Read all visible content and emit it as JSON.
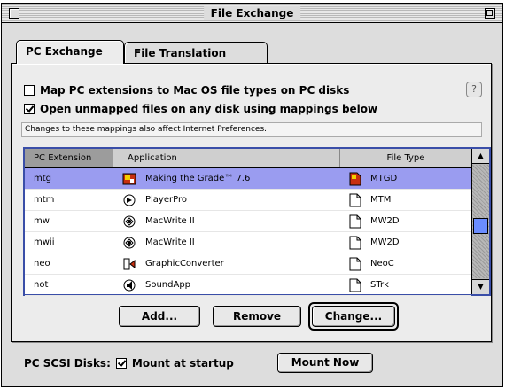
{
  "window": {
    "title": "File Exchange"
  },
  "tabs": [
    {
      "label": "PC Exchange",
      "active": true
    },
    {
      "label": "File Translation",
      "active": false
    }
  ],
  "options": {
    "map_extensions": {
      "label": "Map PC extensions to Mac OS file types on PC disks",
      "checked": false
    },
    "open_unmapped": {
      "label": "Open unmapped files on any disk using mappings below",
      "checked": true
    }
  },
  "help_label": "?",
  "notice": "Changes to these mappings also affect Internet Preferences.",
  "table": {
    "headers": {
      "extension": "PC Extension",
      "application": "Application",
      "file_type": "File Type"
    },
    "rows": [
      {
        "ext": "mtg",
        "app": "Making the Grade™ 7.6",
        "type": "MTGD",
        "selected": true,
        "icon": "grade-app-icon"
      },
      {
        "ext": "mtm",
        "app": "PlayerPro",
        "type": "MTM",
        "selected": false,
        "icon": "player-app-icon"
      },
      {
        "ext": "mw",
        "app": "MacWrite II",
        "type": "MW2D",
        "selected": false,
        "icon": "macwrite-app-icon"
      },
      {
        "ext": "mwii",
        "app": "MacWrite II",
        "type": "MW2D",
        "selected": false,
        "icon": "macwrite-app-icon"
      },
      {
        "ext": "neo",
        "app": "GraphicConverter",
        "type": "NeoC",
        "selected": false,
        "icon": "graphic-app-icon"
      },
      {
        "ext": "not",
        "app": "SoundApp",
        "type": "STrk",
        "selected": false,
        "icon": "sound-app-icon"
      }
    ]
  },
  "buttons": {
    "add": "Add...",
    "remove": "Remove",
    "change": "Change..."
  },
  "scsi": {
    "label": "PC SCSI Disks:",
    "mount_label": "Mount at startup",
    "mount_checked": true,
    "mount_now": "Mount Now"
  },
  "colors": {
    "selection": "#9a9cf0",
    "list_border": "#3a4ea8",
    "scroll_thumb": "#6a8cff"
  }
}
